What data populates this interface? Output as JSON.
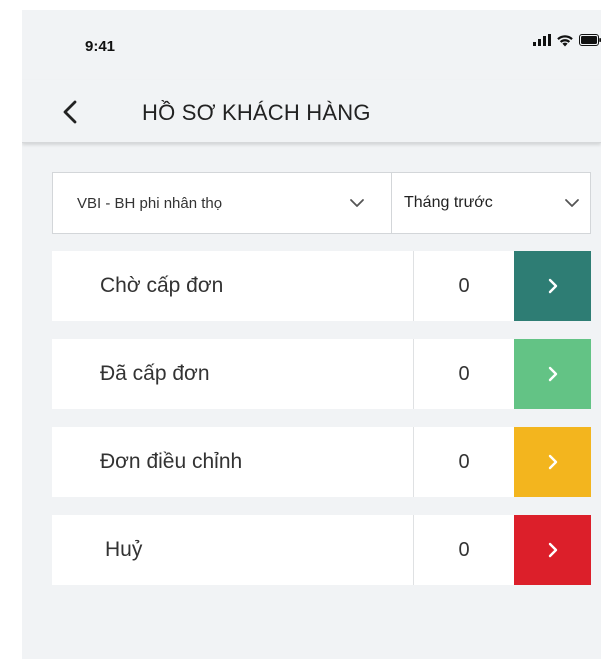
{
  "status_bar": {
    "time": "9:41",
    "icons": [
      "signal-icon",
      "wifi-icon",
      "battery-icon"
    ]
  },
  "header": {
    "back_icon": "chevron-left-icon",
    "title": "HỒ SƠ KHÁCH HÀNG"
  },
  "filters": {
    "product": {
      "value": "VBI - BH phi nhân thọ",
      "icon": "chevron-down-icon"
    },
    "period": {
      "value": "Tháng trước",
      "icon": "chevron-down-icon"
    }
  },
  "statuses": [
    {
      "label": "Chờ cấp đơn",
      "count": "0",
      "color": "#2e7d74",
      "icon": "chevron-right-icon"
    },
    {
      "label": "Đã cấp đơn",
      "count": "0",
      "color": "#63c385",
      "icon": "chevron-right-icon"
    },
    {
      "label": "Đơn điều chỉnh",
      "count": "0",
      "color": "#f3b51e",
      "icon": "chevron-right-icon"
    },
    {
      "label": "Huỷ",
      "count": "0",
      "color": "#dc1f2a",
      "icon": "chevron-right-icon"
    }
  ],
  "colors": {
    "background": "#f1f3f5",
    "card": "#ffffff",
    "text": "#333333"
  }
}
